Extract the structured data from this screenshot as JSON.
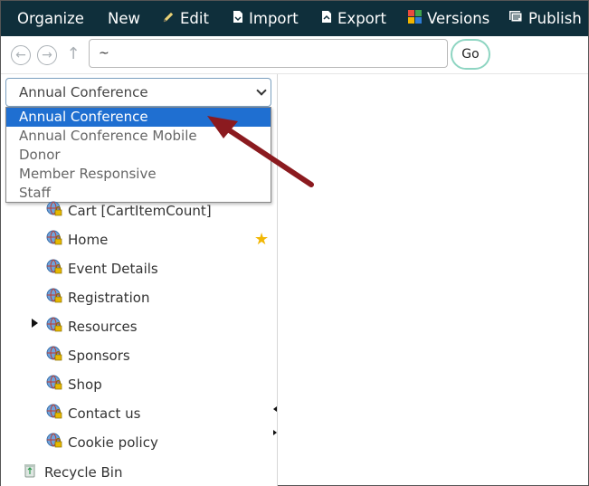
{
  "toolbar": {
    "organize": "Organize",
    "new": "New",
    "edit": "Edit",
    "import": "Import",
    "export": "Export",
    "versions": "Versions",
    "publish": "Publish"
  },
  "nav": {
    "path_value": "~",
    "go_label": "Go"
  },
  "site_select": {
    "selected": "Annual Conference",
    "options": [
      "Annual Conference",
      "Annual Conference Mobile",
      "Donor",
      "Member Responsive",
      "Staff"
    ]
  },
  "tree": {
    "items": [
      "Cart [CartItemCount]",
      "Home",
      "Event Details",
      "Registration",
      "Resources",
      "Sponsors",
      "Shop",
      "Contact us",
      "Cookie policy"
    ],
    "recycle_bin": "Recycle Bin"
  },
  "colors": {
    "toolbar_bg": "#0f2f3b",
    "selected_option": "#1f6fd1",
    "annotation_arrow": "#8b1a1f",
    "go_border": "#8ed5c2"
  }
}
